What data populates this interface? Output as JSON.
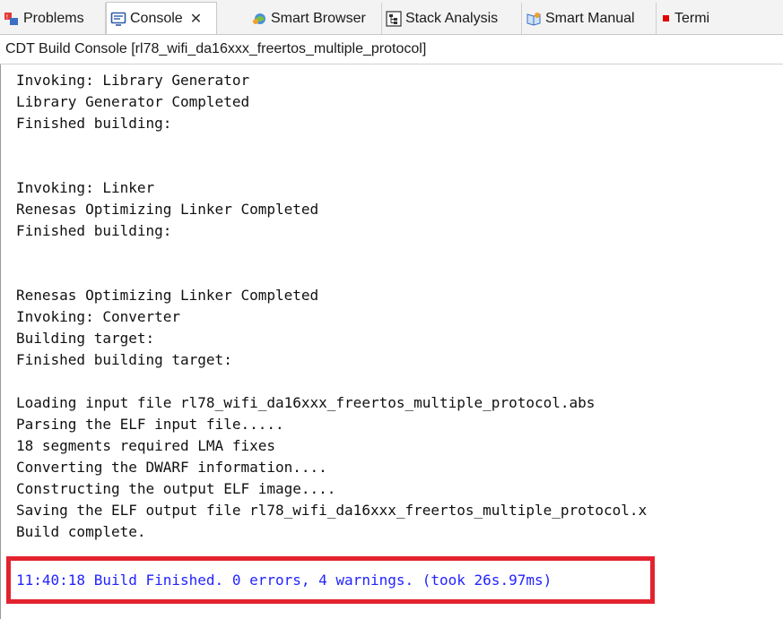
{
  "tabs": [
    {
      "label": "Problems",
      "icon": "problems-icon"
    },
    {
      "label": "Console",
      "icon": "console-icon",
      "active": true,
      "closable": true
    },
    {
      "label": "Smart Browser",
      "icon": "smart-browser-icon"
    },
    {
      "label": "Stack Analysis",
      "icon": "stack-analysis-icon"
    },
    {
      "label": "Smart Manual",
      "icon": "smart-manual-icon"
    },
    {
      "label": "Termi",
      "icon": "terminal-icon"
    }
  ],
  "console_title": "CDT Build Console [rl78_wifi_da16xxx_freertos_multiple_protocol]",
  "lines": [
    "Invoking: Library Generator",
    "Library Generator Completed",
    "Finished building:",
    "",
    "",
    "Invoking: Linker",
    "Renesas Optimizing Linker Completed",
    "Finished building:",
    "",
    "",
    "Renesas Optimizing Linker Completed",
    "Invoking: Converter",
    "Building target:",
    "Finished building target:",
    "",
    "Loading input file rl78_wifi_da16xxx_freertos_multiple_protocol.abs",
    "Parsing the ELF input file.....",
    "18 segments required LMA fixes",
    "Converting the DWARF information....",
    "Constructing the output ELF image....",
    "Saving the ELF output file rl78_wifi_da16xxx_freertos_multiple_protocol.x",
    "Build complete."
  ],
  "final_line": "11:40:18 Build Finished. 0 errors, 4 warnings. (took 26s.97ms)",
  "colors": {
    "highlight_border": "#e3232e",
    "final_line_text": "#2323ff",
    "terminal_square": "#e00000"
  }
}
